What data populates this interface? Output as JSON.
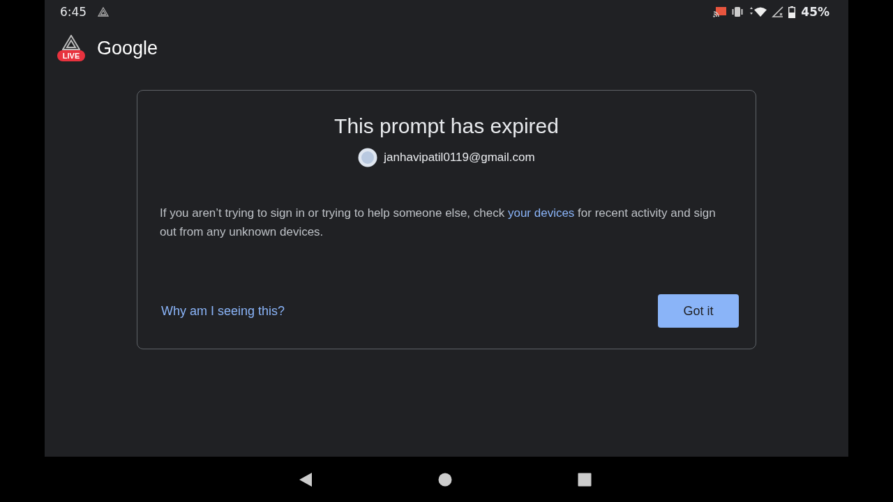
{
  "status_bar": {
    "time": "6:45",
    "battery": "45%"
  },
  "header": {
    "live_badge": "LIVE",
    "logo": "Google"
  },
  "dialog": {
    "title": "This prompt has expired",
    "account": "janhavipatil0119@gmail.com",
    "message": {
      "before": "If you aren’t trying to sign in or trying to help someone else, check ",
      "link": "your devices",
      "after": " for recent activity and sign out from any unknown devices."
    },
    "help_link": "Why am I seeing this?",
    "button": "Got it"
  }
}
